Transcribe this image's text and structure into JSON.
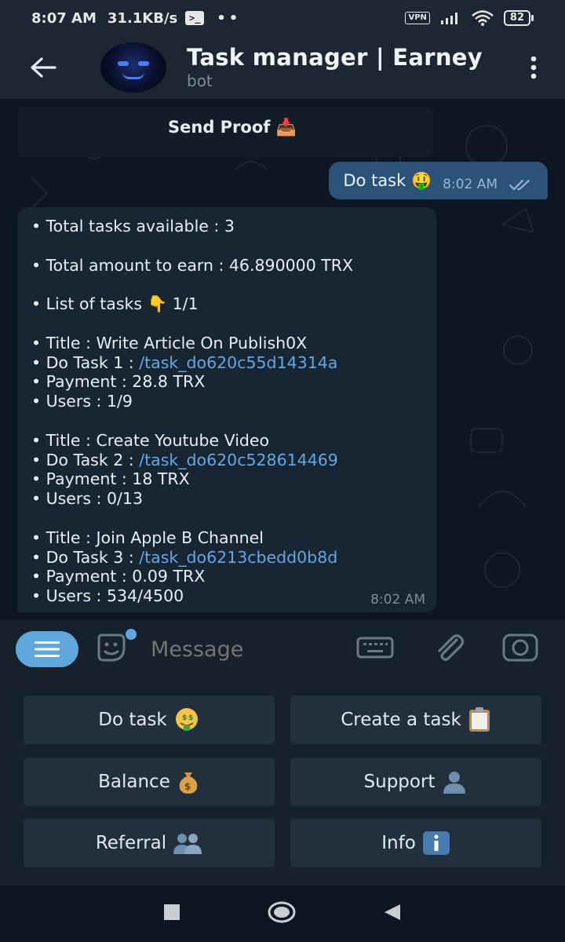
{
  "status_bar": {
    "time": "8:07 AM",
    "speed": "31.1KB/s",
    "terminal_glyph": ">_",
    "dots": "••",
    "vpn": "VPN",
    "battery": "82"
  },
  "header": {
    "title": "Task manager | Earney",
    "subtitle": "bot"
  },
  "pinned": {
    "label": "Send Proof",
    "emoji": "📥"
  },
  "outgoing": {
    "text": "Do task 🤑",
    "time": "8:02 AM"
  },
  "incoming": {
    "lines": [
      "• Total tasks available : 3",
      "",
      "• Total amount to earn : 46.890000 TRX",
      "",
      "• List of tasks  👇 1/1",
      "",
      "• Title : Write Article On Publish0X",
      "• Do Task 1 : ",
      "• Payment : 28.8 TRX",
      "• Users : 1/9",
      "",
      "• Title : Create Youtube Video",
      "• Do Task 2 : ",
      "• Payment : 18 TRX",
      "• Users : 0/13",
      "",
      "• Title : Join Apple B Channel",
      "• Do Task 3 : ",
      "• Payment : 0.09 TRX",
      "• Users : 534/4500"
    ],
    "links": {
      "task1": "/task_do620c55d14314a",
      "task2": "/task_do620c528614469",
      "task3": "/task_do6213cbedd0b8d"
    },
    "time": "8:02 AM"
  },
  "input": {
    "placeholder": "Message"
  },
  "keyboard": {
    "do_task": "Do task",
    "create_task": "Create a task",
    "balance": "Balance",
    "support": "Support",
    "referral": "Referral",
    "info": "Info"
  },
  "colors": {
    "accent": "#5ea8dd",
    "link": "#62a8e5",
    "outgoing_bubble": "#2b5278",
    "incoming_bubble": "#182533"
  }
}
